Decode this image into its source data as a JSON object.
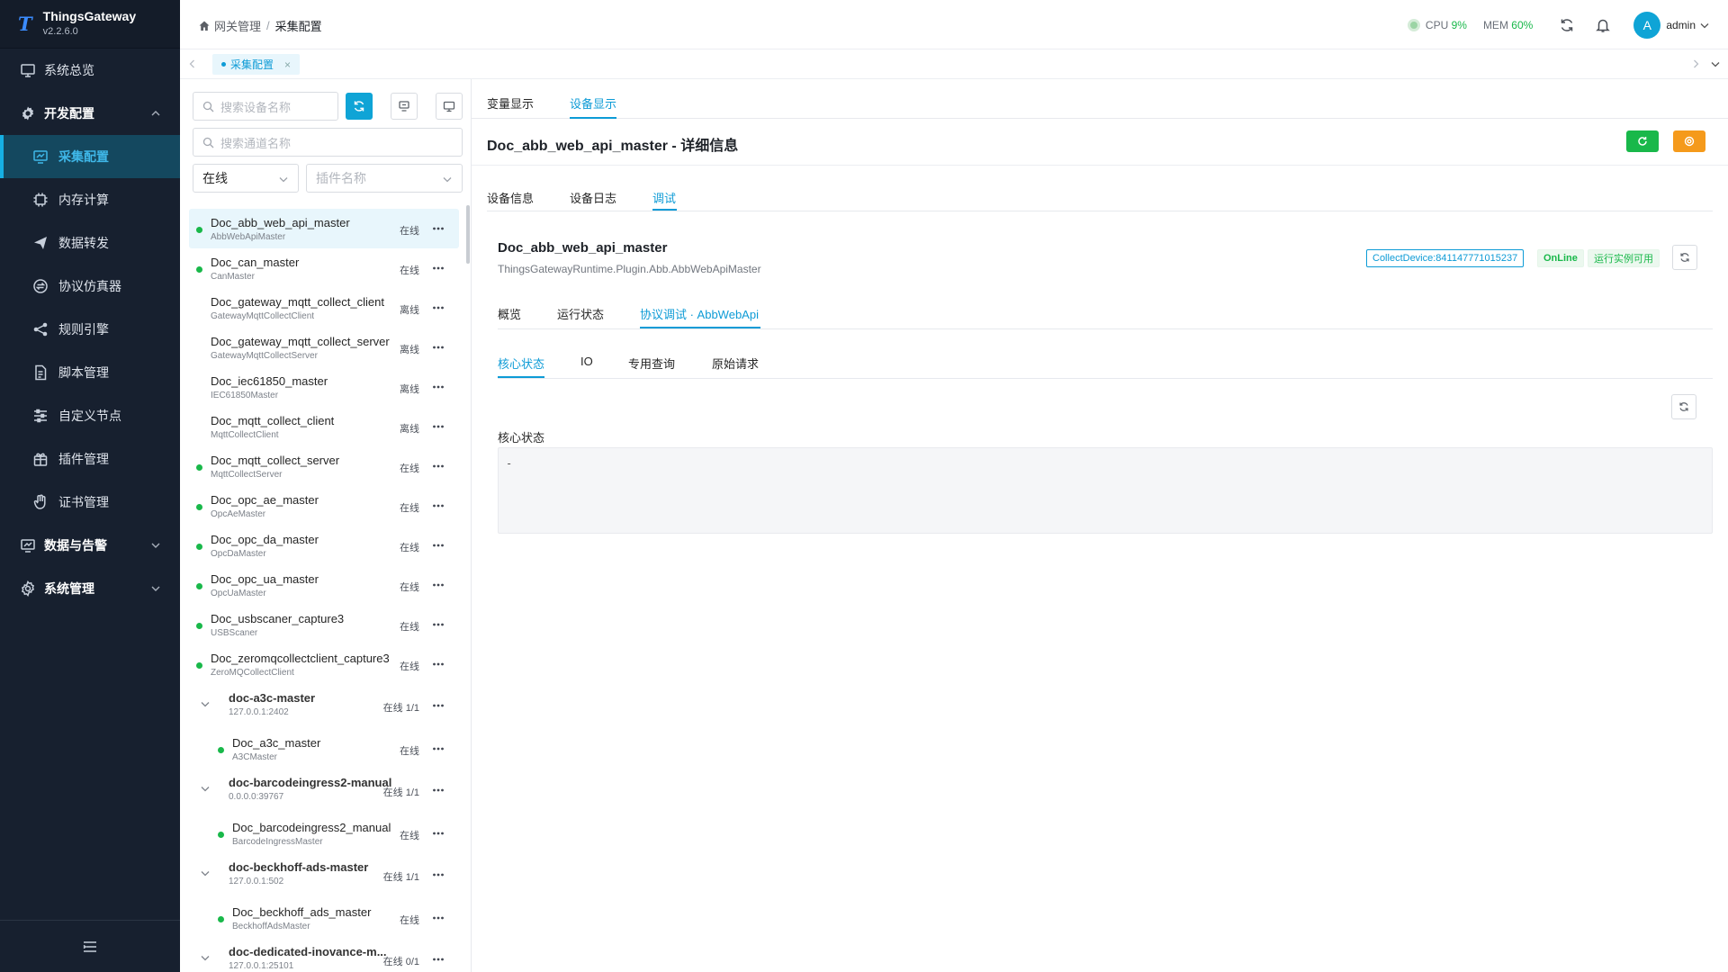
{
  "brand": {
    "name": "ThingsGateway",
    "version": "v2.2.6.0"
  },
  "sidebar": {
    "items": [
      {
        "label": "系统总览"
      },
      {
        "label": "开发配置"
      },
      {
        "label": "采集配置"
      },
      {
        "label": "内存计算"
      },
      {
        "label": "数据转发"
      },
      {
        "label": "协议仿真器"
      },
      {
        "label": "规则引擎"
      },
      {
        "label": "脚本管理"
      },
      {
        "label": "自定义节点"
      },
      {
        "label": "插件管理"
      },
      {
        "label": "证书管理"
      },
      {
        "label": "数据与告警"
      },
      {
        "label": "系统管理"
      }
    ]
  },
  "header": {
    "breadcrumb": [
      "网关管理",
      "/",
      "采集配置"
    ],
    "cpu_label": "CPU",
    "cpu_value": "9%",
    "mem_label": "MEM",
    "mem_value": "60%",
    "avatar_letter": "A",
    "user": "admin"
  },
  "tabsbar": {
    "open_tab": "采集配置",
    "close": "×"
  },
  "devpanel": {
    "search_device_placeholder": "搜索设备名称",
    "search_channel_placeholder": "搜索通道名称",
    "status_filter": "在线",
    "plugin_filter_placeholder": "插件名称",
    "rows": [
      {
        "name": "Doc_abb_web_api_master",
        "plugin": "AbbWebApiMaster",
        "status": "在线"
      },
      {
        "name": "Doc_can_master",
        "plugin": "CanMaster",
        "status": "在线"
      },
      {
        "name": "Doc_gateway_mqtt_collect_client",
        "plugin": "GatewayMqttCollectClient",
        "status": "离线"
      },
      {
        "name": "Doc_gateway_mqtt_collect_server",
        "plugin": "GatewayMqttCollectServer",
        "status": "离线"
      },
      {
        "name": "Doc_iec61850_master",
        "plugin": "IEC61850Master",
        "status": "离线"
      },
      {
        "name": "Doc_mqtt_collect_client",
        "plugin": "MqttCollectClient",
        "status": "离线"
      },
      {
        "name": "Doc_mqtt_collect_server",
        "plugin": "MqttCollectServer",
        "status": "在线"
      },
      {
        "name": "Doc_opc_ae_master",
        "plugin": "OpcAeMaster",
        "status": "在线"
      },
      {
        "name": "Doc_opc_da_master",
        "plugin": "OpcDaMaster",
        "status": "在线"
      },
      {
        "name": "Doc_opc_ua_master",
        "plugin": "OpcUaMaster",
        "status": "在线"
      },
      {
        "name": "Doc_usbscaner_capture3",
        "plugin": "USBScaner",
        "status": "在线"
      },
      {
        "name": "Doc_zeromqcollectclient_capture3",
        "plugin": "ZeroMQCollectClient",
        "status": "在线"
      },
      {
        "name": "doc-a3c-master",
        "plugin": "127.0.0.1:2402",
        "status": "在线 1/1"
      },
      {
        "name": "Doc_a3c_master",
        "plugin": "A3CMaster",
        "status": "在线"
      },
      {
        "name": "doc-barcodeingress2-manual",
        "plugin": "0.0.0.0:39767",
        "status": "在线 1/1"
      },
      {
        "name": "Doc_barcodeingress2_manual",
        "plugin": "BarcodeIngressMaster",
        "status": "在线"
      },
      {
        "name": "doc-beckhoff-ads-master",
        "plugin": "127.0.0.1:502",
        "status": "在线 1/1"
      },
      {
        "name": "Doc_beckhoff_ads_master",
        "plugin": "BeckhoffAdsMaster",
        "status": "在线"
      },
      {
        "name": "doc-dedicated-inovance-m...",
        "plugin": "127.0.0.1:25101",
        "status": "在线 0/1"
      }
    ]
  },
  "detail": {
    "top_tabs": [
      "变量显示",
      "设备显示"
    ],
    "title": "Doc_abb_web_api_master - 详细信息",
    "sub_tabs": [
      "设备信息",
      "设备日志",
      "调试"
    ],
    "device_name": "Doc_abb_web_api_master",
    "plugin_path": "ThingsGatewayRuntime.Plugin.Abb.AbbWebApiMaster",
    "tag_collect": "CollectDevice:841147771015237",
    "tag_online": "OnLine",
    "tag_runtime": "运行实例可用",
    "debug_tabs": [
      "概览",
      "运行状态",
      "协议调试 · AbbWebApi"
    ],
    "inner_tabs": [
      "核心状态",
      "IO",
      "专用查询",
      "原始请求"
    ],
    "section_title": "核心状态",
    "code_content": "-"
  },
  "colors": {
    "accent": "#0d9bd6",
    "online": "#19b84a",
    "warning": "#f59a1b",
    "sidebar_bg": "#17202f"
  }
}
